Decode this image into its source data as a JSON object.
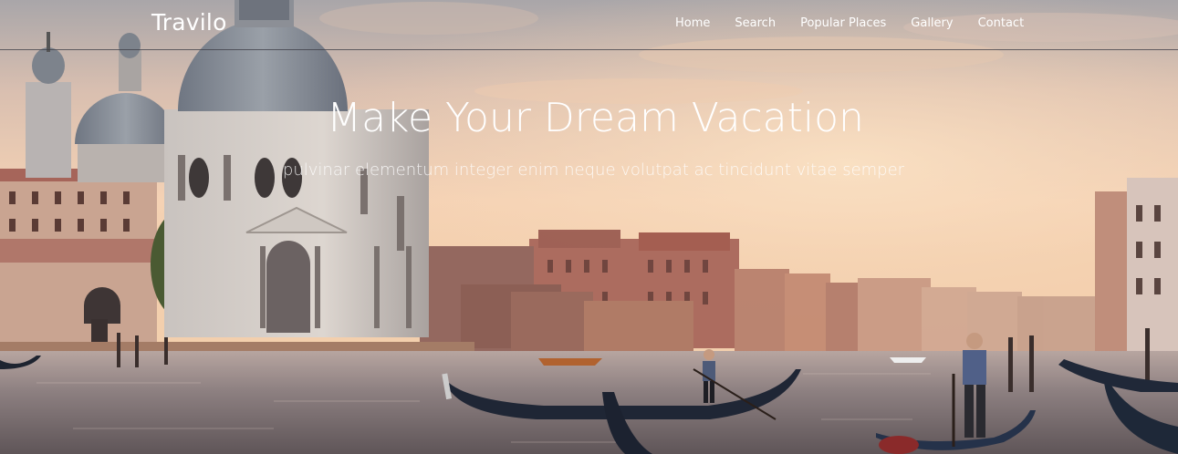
{
  "brand": "Travilo",
  "nav": {
    "items": [
      {
        "label": "Home"
      },
      {
        "label": "Search"
      },
      {
        "label": "Popular Places"
      },
      {
        "label": "Gallery"
      },
      {
        "label": "Contact"
      }
    ]
  },
  "hero": {
    "title": "Make Your Dream Vacation",
    "subtitle": "pulvinar elementum integer enim neque volutpat ac tincidunt vitae semper"
  },
  "colors": {
    "sky_top": "#a7a2a5",
    "sky_glow": "#f6d2b1",
    "water": "#6f6466",
    "text": "#ffffff"
  }
}
